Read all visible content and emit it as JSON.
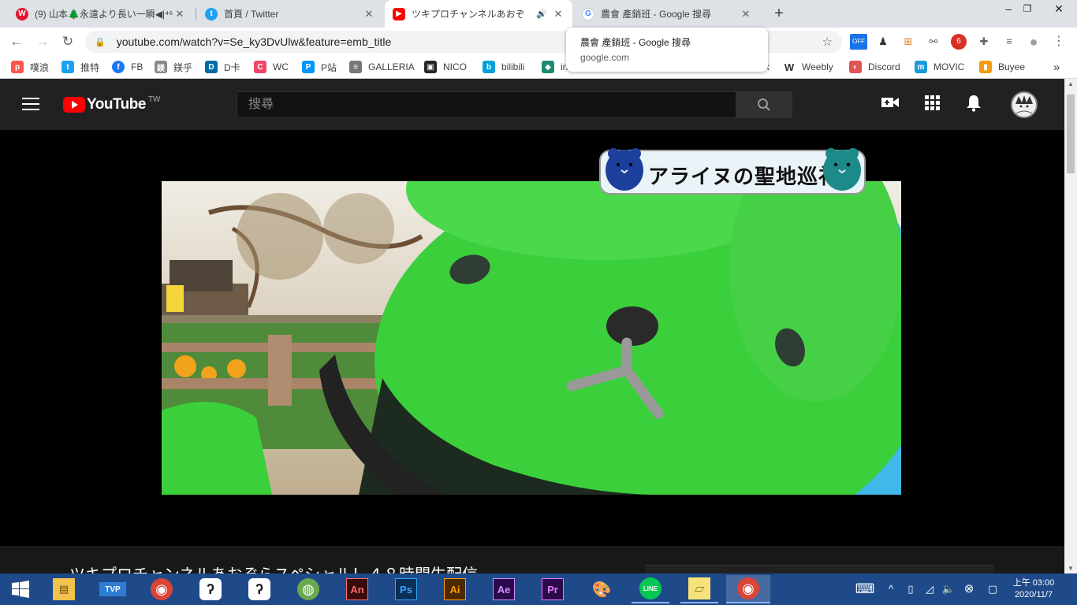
{
  "browser": {
    "tabs": [
      {
        "title": "(9) 山本🌲永遠より長い一瞬◀|⁴⁶",
        "close": "✕",
        "icon": "weibo-icon",
        "color": "#e6162d"
      },
      {
        "title": "首頁 / Twitter",
        "close": "✕",
        "icon": "twitter-icon",
        "color": "#1da1f2"
      },
      {
        "title": "ツキプロチャンネルあおぞ",
        "close": "✕",
        "icon": "youtube-icon",
        "color": "#ff0000",
        "audio": "🔊"
      },
      {
        "title": "農會 產銷班 - Google 搜尋",
        "close": "✕",
        "icon": "google-icon",
        "color": "#4285f4"
      }
    ],
    "new_tab": "+",
    "window_controls": {
      "minimize": "–",
      "restore": "❐",
      "close": "✕"
    },
    "url": "youtube.com/watch?v=Se_ky3DvUlw&feature=emb_title",
    "extensions": [
      {
        "icon": "off-badge-icon",
        "label": "OFF"
      },
      {
        "icon": "tampermonkey-icon",
        "label": "♟"
      },
      {
        "icon": "puzzle-extension-icon",
        "label": "⊞"
      },
      {
        "icon": "bicycle-icon",
        "label": "⚯"
      },
      {
        "icon": "extension-badge-icon",
        "label": "6"
      },
      {
        "icon": "extensions-icon",
        "label": "✚"
      },
      {
        "icon": "media-control-icon",
        "label": "≡"
      },
      {
        "icon": "profile-icon",
        "label": "●"
      },
      {
        "icon": "menu-icon",
        "label": "⋮"
      }
    ],
    "bookmarks": [
      {
        "label": "噗浪",
        "color": "#ff574d"
      },
      {
        "label": "推特",
        "color": "#1da1f2"
      },
      {
        "label": "FB",
        "color": "#1877f2"
      },
      {
        "label": "鎂乎",
        "color": "#888888"
      },
      {
        "label": "D卡",
        "color": "#006aa6"
      },
      {
        "label": "WC",
        "color": "#ef4566"
      },
      {
        "label": "P站",
        "color": "#0096fa"
      },
      {
        "label": "GALLERIA",
        "color": "#777777"
      },
      {
        "label": "NICO",
        "color": "#252525"
      },
      {
        "label": "bilibili",
        "color": "#00a1d6"
      },
      {
        "label": "in",
        "color": "#1f8a70"
      }
    ],
    "bookmarks_right": [
      {
        "label": "k",
        "color": "#666666"
      },
      {
        "label": "Weebly",
        "color": "#333333"
      },
      {
        "label": "Discord",
        "color": "#e05454"
      },
      {
        "label": "MOVIC",
        "color": "#1a9bd7"
      },
      {
        "label": "Buyee",
        "color": "#f39c12"
      }
    ],
    "bookmarks_more": "»",
    "tooltip": {
      "title": "農會 產銷班 - Google 搜尋",
      "domain": "google.com"
    }
  },
  "youtube": {
    "logo": "YouTube",
    "country": "TW",
    "search_placeholder": "搜尋",
    "video_overlay_text": "アライヌの聖地巡礼",
    "video_title": "ツキプロチャンネルあおぞらスペシャル！４８時間生配信"
  },
  "taskbar": {
    "apps": [
      {
        "name": "start-button",
        "label": "⊞",
        "color": "#1f4a8a"
      },
      {
        "name": "file-explorer-icon",
        "label": "▤",
        "color": "#f2c14e"
      },
      {
        "name": "tvp-icon",
        "label": "TVP",
        "color": "#2d7dd2"
      },
      {
        "name": "chrome-icon",
        "label": "◉",
        "color": "#db4437"
      },
      {
        "name": "clip-studio-icon",
        "label": "ʔ",
        "color": "#ffffff"
      },
      {
        "name": "clip-studio-alt-icon",
        "label": "ʔ",
        "color": "#ffffff"
      },
      {
        "name": "planet-app-icon",
        "label": "◍",
        "color": "#6aa84f"
      },
      {
        "name": "adobe-animate-icon",
        "label": "An",
        "color": "#c0392b"
      },
      {
        "name": "adobe-photoshop-icon",
        "label": "Ps",
        "color": "#0b2f57"
      },
      {
        "name": "adobe-illustrator-icon",
        "label": "Ai",
        "color": "#4b2a00"
      },
      {
        "name": "adobe-after-effects-icon",
        "label": "Ae",
        "color": "#2a0a4a"
      },
      {
        "name": "adobe-premiere-icon",
        "label": "Pr",
        "color": "#2a0a4a"
      },
      {
        "name": "paint-palette-icon",
        "label": "🎨",
        "color": "#9bb8d3"
      },
      {
        "name": "line-icon",
        "label": "LINE",
        "color": "#06c755"
      },
      {
        "name": "sticky-notes-icon",
        "label": "▱",
        "color": "#f7e27a"
      },
      {
        "name": "chrome-running-icon",
        "label": "◉",
        "color": "#db4437"
      }
    ],
    "tray": [
      {
        "name": "keyboard-icon",
        "label": "⌨"
      },
      {
        "name": "tray-expand-icon",
        "label": "^"
      },
      {
        "name": "device-icon",
        "label": "▯"
      },
      {
        "name": "wifi-icon",
        "label": "◿"
      },
      {
        "name": "volume-icon",
        "label": "🔈"
      },
      {
        "name": "notification-close-icon",
        "label": "⊗"
      },
      {
        "name": "action-center-icon",
        "label": "▢"
      }
    ],
    "time": "上午 03:00",
    "date": "2020/11/7"
  },
  "colors": {
    "tabstrip": "#dee1e6",
    "yt_dark": "#212121",
    "yt_red": "#ff0000",
    "taskbar": "#1f4a8a",
    "plush_green": "#3ccf3c"
  }
}
